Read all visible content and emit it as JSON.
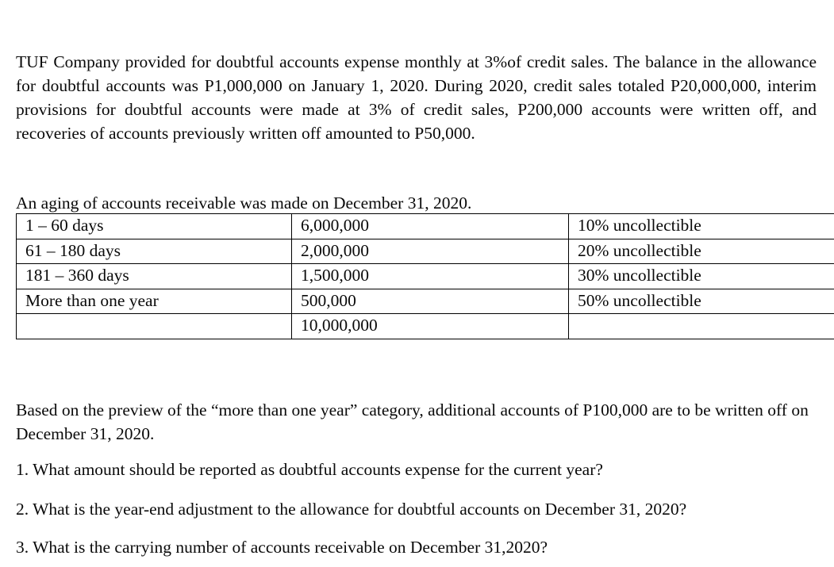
{
  "document": {
    "background_color": "#ffffff",
    "text_color": "#0a0a0a",
    "intro_paragraph": "TUF Company provided for doubtful accounts expense monthly at 3%of credit sales. The balance in the allowance for doubtful accounts was P1,000,000 on January 1, 2020. During 2020, credit sales totaled P20,000,000, interim provisions for doubtful accounts were made at 3% of credit sales, P200,000 accounts were written off, and recoveries of accounts previously written off amounted to P50,000.",
    "aging_note": "An aging of accounts receivable was made on December 31, 2020.",
    "preview_note": "Based on the preview of the “more than one year” category, additional accounts of P100,000 are to be written off on December 31, 2020.",
    "aging_table": {
      "rows": [
        {
          "bracket": "1 – 60 days",
          "amount": "6,000,000",
          "rate": "10% uncollectible"
        },
        {
          "bracket": "61 – 180 days",
          "amount": "2,000,000",
          "rate": "20% uncollectible"
        },
        {
          "bracket": "181 – 360 days",
          "amount": "1,500,000",
          "rate": "30% uncollectible"
        },
        {
          "bracket": "More than one year",
          "amount": "500,000",
          "rate": "50% uncollectible"
        },
        {
          "bracket": "",
          "amount": "10,000,000",
          "rate": ""
        }
      ]
    },
    "questions": [
      "1. What amount should be reported as doubtful accounts expense for the current year?",
      "2. What is the year-end adjustment to the allowance for doubtful accounts on December 31, 2020?",
      "3. What is the carrying number of accounts receivable on December 31,2020?"
    ]
  }
}
